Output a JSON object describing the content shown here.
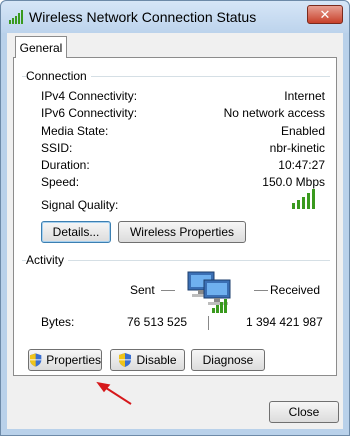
{
  "window": {
    "title": "Wireless Network Connection Status",
    "close_glyph": "✕"
  },
  "tabs": [
    {
      "label": "General"
    }
  ],
  "connection": {
    "heading": "Connection",
    "rows": [
      {
        "label": "IPv4 Connectivity:",
        "value": "Internet"
      },
      {
        "label": "IPv6 Connectivity:",
        "value": "No network access"
      },
      {
        "label": "Media State:",
        "value": "Enabled"
      },
      {
        "label": "SSID:",
        "value": "nbr-kinetic"
      },
      {
        "label": "Duration:",
        "value": "10:47:27"
      },
      {
        "label": "Speed:",
        "value": "150.0 Mbps"
      }
    ],
    "signal_label": "Signal Quality:",
    "signal_bars": 5,
    "details_button": "Details...",
    "wireless_properties_button": "Wireless Properties"
  },
  "activity": {
    "heading": "Activity",
    "sent_label": "Sent",
    "received_label": "Received",
    "bytes_label": "Bytes:",
    "bytes_sent": "76 513 525",
    "bytes_received": "1 394 421 987"
  },
  "actions": {
    "properties_button": "Properties",
    "disable_button": "Disable",
    "diagnose_button": "Diagnose"
  },
  "footer": {
    "close_button": "Close"
  },
  "colors": {
    "signal": "#3a9a1e",
    "annotation_arrow": "#d6181b",
    "title_bar": "#bcd3ec"
  },
  "icons": [
    "signal-strength-icon",
    "network-computers-icon",
    "uac-shield-icon",
    "annotation-arrow"
  ]
}
